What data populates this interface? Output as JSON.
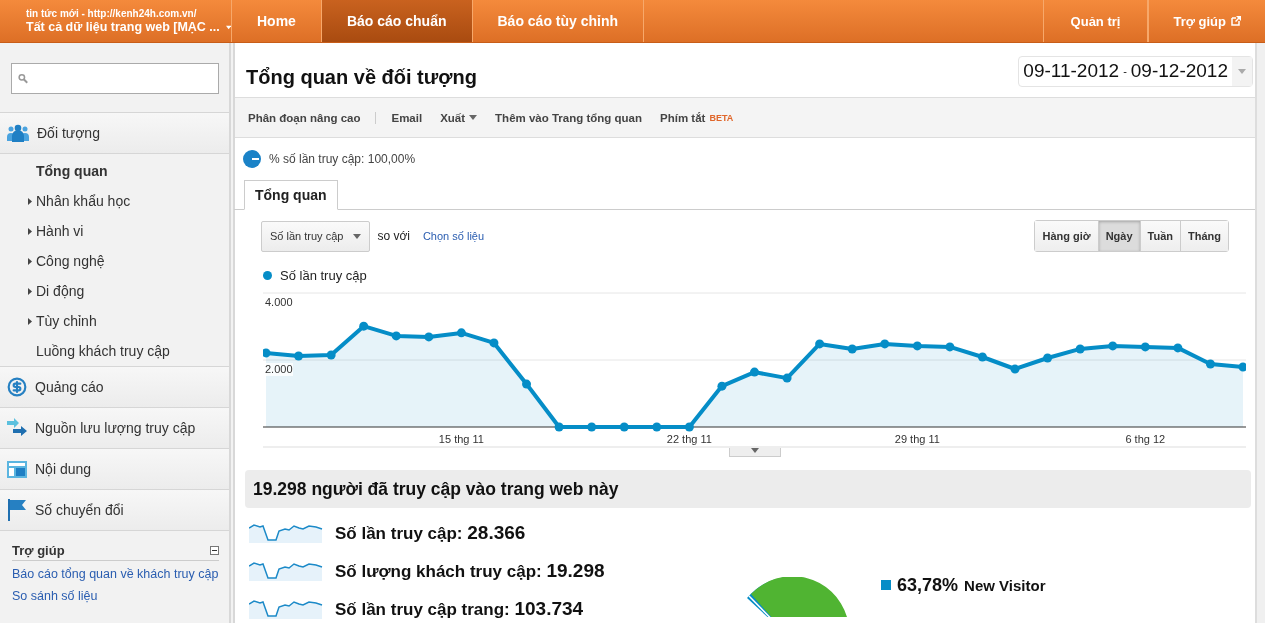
{
  "topbar": {
    "account": {
      "subtitle": "tin tức mới - http://kenh24h.com.vn/",
      "title": "Tất cả dữ liệu trang web [MẠC ..."
    },
    "nav": [
      {
        "label": "Home",
        "selected": false
      },
      {
        "label": "Báo cáo chuẩn",
        "selected": true
      },
      {
        "label": "Báo cáo tùy chỉnh",
        "selected": false
      }
    ],
    "right": [
      {
        "label": "Quản trị",
        "external": false
      },
      {
        "label": "Trợ giúp",
        "external": true
      }
    ]
  },
  "sidebar": {
    "sections": [
      {
        "kind": "audience",
        "label": "Đối tượng",
        "children": [
          {
            "label": "Tổng quan",
            "selected": true,
            "expandable": false
          },
          {
            "label": "Nhân khẩu học",
            "selected": false,
            "expandable": true
          },
          {
            "label": "Hành vi",
            "selected": false,
            "expandable": true
          },
          {
            "label": "Công nghệ",
            "selected": false,
            "expandable": true
          },
          {
            "label": "Di động",
            "selected": false,
            "expandable": true
          },
          {
            "label": "Tùy chỉnh",
            "selected": false,
            "expandable": true
          },
          {
            "label": "Luồng khách truy cập",
            "selected": false,
            "expandable": false
          }
        ]
      },
      {
        "kind": "ads",
        "label": "Quảng cáo"
      },
      {
        "kind": "traffic",
        "label": "Nguồn lưu lượng truy cập"
      },
      {
        "kind": "content",
        "label": "Nội dung"
      },
      {
        "kind": "conversion",
        "label": "Số chuyển đổi"
      }
    ],
    "help": {
      "title": "Trợ giúp",
      "expanded": true,
      "links": [
        "Báo cáo tổng quan về khách truy cập",
        "So sánh số liệu"
      ]
    }
  },
  "main": {
    "title": "Tổng quan về đối tượng",
    "date_range": {
      "start": "09-11-2012",
      "separator": "-",
      "end": "09-12-2012"
    },
    "toolbar": [
      {
        "label": "Phân đoạn nâng cao",
        "dropdown": false
      },
      {
        "label": "Email",
        "dropdown": false
      },
      {
        "label": "Xuất",
        "dropdown": true
      },
      {
        "label": "Thêm vào Trang tổng quan",
        "dropdown": false
      },
      {
        "label": "Phím tắt",
        "dropdown": false,
        "badge": "BETA"
      }
    ],
    "segment": "% số lần truy cập: 100,00%",
    "tabs": [
      {
        "label": "Tổng quan",
        "selected": true
      }
    ],
    "metric_select": "Số lần truy cập",
    "compare_text": "so với",
    "compare_link": "Chọn số liệu",
    "intervals": [
      {
        "label": "Hàng giờ",
        "selected": false
      },
      {
        "label": "Ngày",
        "selected": true
      },
      {
        "label": "Tuần",
        "selected": false
      },
      {
        "label": "Tháng",
        "selected": false
      }
    ],
    "chart_data": {
      "type": "area",
      "ylim": [
        0,
        4000
      ],
      "yticks": [
        {
          "value": 2000,
          "label": "2.000"
        },
        {
          "value": 4000,
          "label": "4.000"
        }
      ],
      "categories": [
        null,
        null,
        null,
        null,
        null,
        null,
        "15 thg 11",
        null,
        null,
        null,
        null,
        null,
        null,
        "22 thg 11",
        null,
        null,
        null,
        null,
        null,
        null,
        "29 thg 11",
        null,
        null,
        null,
        null,
        null,
        null,
        "6 thg 12",
        null,
        null,
        null
      ],
      "series": [
        {
          "name": "Số lần truy cập",
          "color": "#058dc7",
          "values": [
            2210,
            2120,
            2150,
            3010,
            2720,
            2690,
            2810,
            2510,
            1280,
            0,
            0,
            0,
            0,
            0,
            1220,
            1640,
            1460,
            2480,
            2330,
            2480,
            2420,
            2390,
            2090,
            1730,
            2060,
            2330,
            2420,
            2390,
            2360,
            1880,
            1790
          ]
        }
      ]
    },
    "summary_title": "19.298 người đã truy cập vào trang web này",
    "metrics": [
      {
        "label": "Số lần truy cập:",
        "value": "28.366"
      },
      {
        "label": "Số lượng khách truy cập:",
        "value": "19.298"
      },
      {
        "label": "Số lần truy cập trang:",
        "value": "103.734"
      }
    ],
    "pie_legend": [
      {
        "percent": "63,78%",
        "label": "New Visitor",
        "color": "#058dc7"
      }
    ]
  }
}
